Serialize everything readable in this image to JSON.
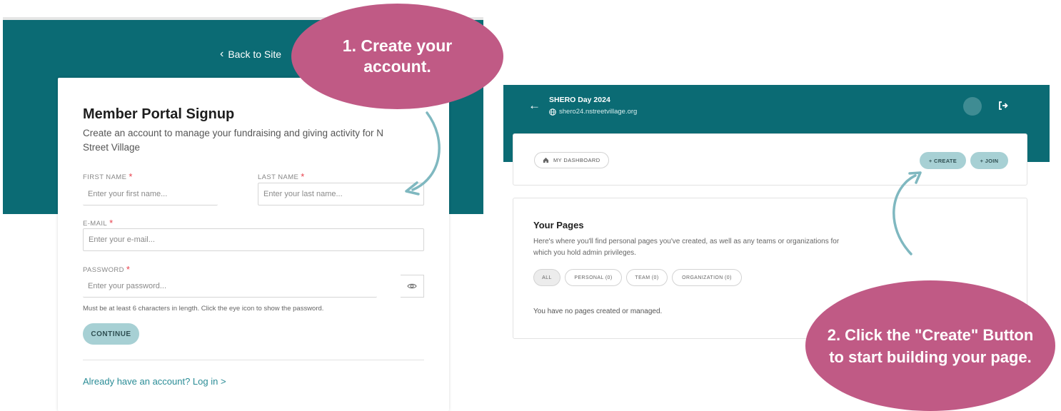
{
  "signup_panel": {
    "back_link": "Back to Site",
    "title": "Member Portal Signup",
    "subtitle": "Create an account to manage your fundraising and giving activity for N Street Village",
    "first_name": {
      "label": "FIRST NAME",
      "required": "*",
      "placeholder": "Enter your first name..."
    },
    "last_name": {
      "label": "LAST NAME",
      "required": "*",
      "placeholder": "Enter your last name..."
    },
    "email": {
      "label": "E-MAIL",
      "required": "*",
      "placeholder": "Enter your e-mail..."
    },
    "password": {
      "label": "PASSWORD",
      "required": "*",
      "placeholder": "Enter your password..."
    },
    "password_hint": "Must be at least 6 characters in length. Click the eye icon to show the password.",
    "continue_label": "CONTINUE",
    "login_link": "Already have an account? Log in >",
    "eye_icon": "eye-icon"
  },
  "dashboard_panel": {
    "site_title": "SHERO Day 2024",
    "site_url": "shero24.nstreetvillage.org",
    "my_dashboard": "MY DASHBOARD",
    "create_label": "+ CREATE",
    "join_label": "+ JOIN",
    "pages_title": "Your Pages",
    "pages_description": "Here's where you'll find personal pages you've created, as well as any teams or organizations for which you hold admin privileges.",
    "filters": [
      "ALL",
      "PERSONAL (0)",
      "TEAM (0)",
      "ORGANIZATION (0)"
    ],
    "empty_message": "You have no pages created or managed."
  },
  "callouts": {
    "step1": "1. Create your account.",
    "step2": "2. Click the \"Create\" Button to start building your page."
  },
  "colors": {
    "teal_header": "#0b6b74",
    "button_light_teal": "#a7d0d4",
    "callout_pink": "#c05a85",
    "link_teal": "#2a8c96",
    "required_red": "#e8414d"
  }
}
